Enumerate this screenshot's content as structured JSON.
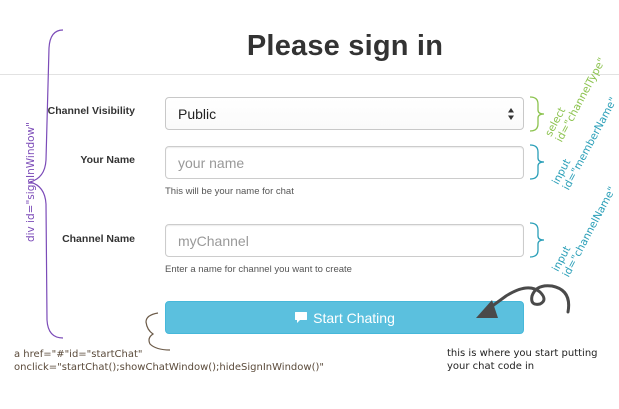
{
  "page_title": "Please sign in",
  "form": {
    "channel_visibility": {
      "label": "Channel Visibility",
      "selected": "Public"
    },
    "your_name": {
      "label": "Your Name",
      "placeholder": "your name",
      "help": "This will be your name for chat"
    },
    "channel_name": {
      "label": "Channel Name",
      "placeholder": "myChannel",
      "help": "Enter a name for channel you want to create"
    },
    "start_button": {
      "label": "Start Chating",
      "icon": "comment-icon"
    }
  },
  "annotations": {
    "signin_window": "div id=\"signInWindow\"",
    "select_channel_type": [
      "select",
      "id=\"channelType\""
    ],
    "input_member_name": [
      "input",
      "id=\"memberName\""
    ],
    "input_channel_name": [
      "input",
      "id=\"channelName\""
    ],
    "start_chat_link": [
      "a href=\"#\"id=\"startChat\"",
      "onclick=\"startChat();showChatWindow();hideSignInWindow()\""
    ],
    "note": [
      "this is where you start putting",
      "your chat code in"
    ]
  },
  "colors": {
    "button": "#5bc0de",
    "annotation_purple": "#7b4bb8",
    "annotation_green": "#8cc34f",
    "annotation_blue": "#2a9fb8"
  }
}
